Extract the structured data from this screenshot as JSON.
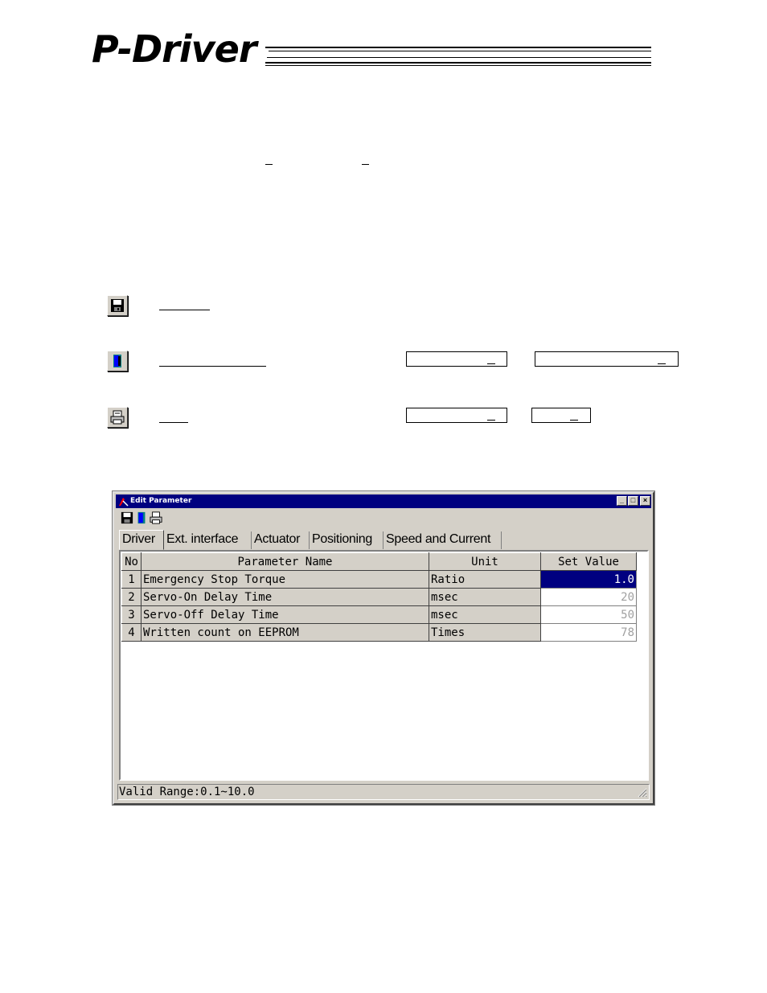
{
  "logo": {
    "text": "P-Driver"
  },
  "window": {
    "title": "Edit Parameter",
    "buttons": {
      "minimize": "_",
      "maximize": "□",
      "close": "×"
    },
    "toolbar": [
      {
        "icon": "save-icon"
      },
      {
        "icon": "transfer-icon"
      },
      {
        "icon": "print-icon"
      }
    ],
    "tabs": [
      {
        "label": "Driver",
        "active": true
      },
      {
        "label": "Ext. interface",
        "active": false
      },
      {
        "label": "Actuator",
        "active": false
      },
      {
        "label": "Positioning",
        "active": false
      },
      {
        "label": "Speed and Current",
        "active": false
      }
    ],
    "table": {
      "columns": [
        "No",
        "Parameter Name",
        "Unit",
        "Set Value"
      ],
      "rows": [
        {
          "no": "1",
          "name": "Emergency Stop Torque",
          "unit": "Ratio",
          "value": "1.0",
          "selected": true
        },
        {
          "no": "2",
          "name": "Servo-On Delay Time",
          "unit": "msec",
          "value": "20",
          "selected": false
        },
        {
          "no": "3",
          "name": "Servo-Off Delay Time",
          "unit": "msec",
          "value": "50",
          "selected": false
        },
        {
          "no": "4",
          "name": "Written count on EEPROM",
          "unit": "Times",
          "value": "78",
          "selected": false
        }
      ]
    },
    "status": "Valid Range:0.1~10.0"
  },
  "colors": {
    "titlebar": "#000080",
    "face": "#d4d0c8",
    "selection": "#000080"
  }
}
